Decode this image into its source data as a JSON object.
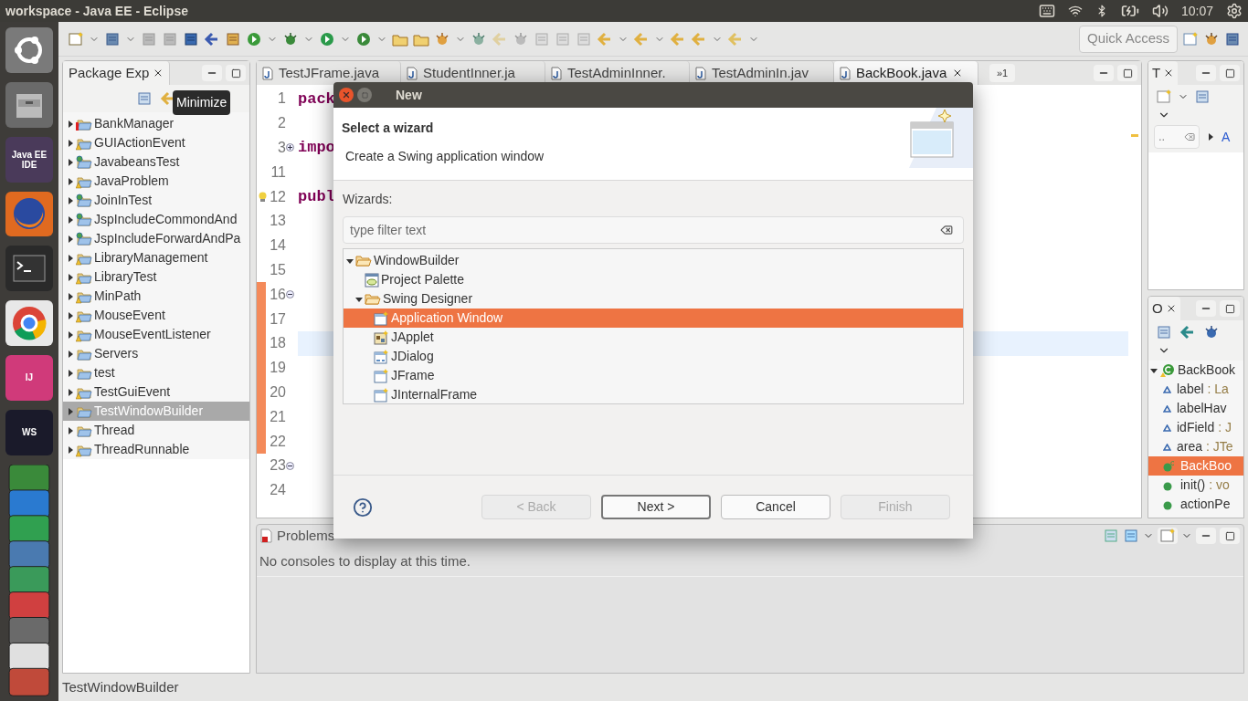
{
  "top_bar": {
    "title": "workspace - Java EE - Eclipse",
    "time": "10:07"
  },
  "launcher": [
    {
      "kind": "ubuntu"
    },
    {
      "kind": "files"
    },
    {
      "kind": "eclipse",
      "label": "Java EE IDE"
    },
    {
      "kind": "firefox"
    },
    {
      "kind": "terminal"
    },
    {
      "kind": "chrome"
    },
    {
      "kind": "intellij",
      "label": "IJ"
    },
    {
      "kind": "webstorm",
      "label": "WS"
    },
    {
      "kind": "stack"
    }
  ],
  "toolbar": {
    "quick_access": "Quick Access"
  },
  "package_explorer": {
    "tab": "Package Exp",
    "tooltip": "Minimize",
    "projects": [
      {
        "name": "BankManager",
        "kind": "error",
        "selected": false
      },
      {
        "name": "GUIActionEvent",
        "kind": "warning",
        "selected": false
      },
      {
        "name": "JavabeansTest",
        "kind": "web",
        "selected": false
      },
      {
        "name": "JavaProblem",
        "kind": "warning",
        "selected": false
      },
      {
        "name": "JoinInTest",
        "kind": "web",
        "selected": false
      },
      {
        "name": "JspIncludeCommondAnd",
        "kind": "web",
        "selected": false
      },
      {
        "name": "JspIncludeForwardAndPa",
        "kind": "web",
        "selected": false
      },
      {
        "name": "LibraryManagement",
        "kind": "warning",
        "selected": false
      },
      {
        "name": "LibraryTest",
        "kind": "warning",
        "selected": false
      },
      {
        "name": "MinPath",
        "kind": "warning",
        "selected": false
      },
      {
        "name": "MouseEvent",
        "kind": "warning",
        "selected": false
      },
      {
        "name": "MouseEventListener",
        "kind": "warning",
        "selected": false
      },
      {
        "name": "Servers",
        "kind": "plain",
        "selected": false
      },
      {
        "name": "test",
        "kind": "plain",
        "selected": false
      },
      {
        "name": "TestGuiEvent",
        "kind": "warning",
        "selected": false
      },
      {
        "name": "TestWindowBuilder",
        "kind": "plain",
        "selected": true
      },
      {
        "name": "Thread",
        "kind": "plain",
        "selected": false
      },
      {
        "name": "ThreadRunnable",
        "kind": "warning",
        "selected": false
      }
    ]
  },
  "editor": {
    "tabs": [
      {
        "label": "TestJFrame.java",
        "selected": false
      },
      {
        "label": "StudentInner.ja",
        "selected": false
      },
      {
        "label": "TestAdminInner.",
        "selected": false
      },
      {
        "label": "TestAdminIn.jav",
        "selected": false
      },
      {
        "label": "BackBook.java",
        "selected": true
      }
    ],
    "overflow": "»1",
    "lines": [
      {
        "number": "1",
        "code": "pack",
        "kind": "plain",
        "changed": false,
        "current": false
      },
      {
        "number": "2",
        "kind": "plain",
        "changed": false,
        "current": false
      },
      {
        "number": "3",
        "code": "impo",
        "kind": "folded",
        "changed": false,
        "current": false
      },
      {
        "number": "11",
        "kind": "plain",
        "changed": false,
        "current": false
      },
      {
        "number": "12",
        "code": "publ",
        "kind": "warning",
        "changed": false,
        "current": false
      },
      {
        "number": "13",
        "kind": "plain",
        "changed": false,
        "current": false
      },
      {
        "number": "14",
        "kind": "plain",
        "changed": false,
        "current": false
      },
      {
        "number": "15",
        "kind": "plain",
        "changed": false,
        "current": false
      },
      {
        "number": "16",
        "kind": "foldable",
        "changed": true,
        "current": false
      },
      {
        "number": "17",
        "kind": "plain",
        "changed": true,
        "current": false
      },
      {
        "number": "18",
        "kind": "plain",
        "changed": true,
        "current": true
      },
      {
        "number": "19",
        "kind": "plain",
        "changed": true,
        "current": false
      },
      {
        "number": "20",
        "kind": "plain",
        "changed": true,
        "current": false
      },
      {
        "number": "21",
        "kind": "plain",
        "changed": true,
        "current": false
      },
      {
        "number": "22",
        "kind": "plain",
        "changed": true,
        "current": false
      },
      {
        "number": "23",
        "kind": "foldable",
        "changed": false,
        "current": false
      },
      {
        "number": "24",
        "kind": "plain",
        "changed": false,
        "current": false
      }
    ]
  },
  "type_hierarchy": {
    "tab": "T",
    "filter": "..",
    "link": "A"
  },
  "outline": {
    "tab": "O",
    "root": "BackBook",
    "members": [
      {
        "name": "label",
        "detail": ": La",
        "kind": "field",
        "selected": false
      },
      {
        "name": "labelHav",
        "kind": "field",
        "selected": false
      },
      {
        "name": "idField",
        "detail": ": J",
        "kind": "field",
        "selected": false
      },
      {
        "name": "area",
        "detail": ": JTe",
        "kind": "field",
        "selected": false
      },
      {
        "name": "BackBoo",
        "kind": "constructor",
        "selected": true
      },
      {
        "name": "init()",
        "detail": ": vo",
        "kind": "method",
        "selected": false
      },
      {
        "name": "actionPe",
        "kind": "method",
        "selected": false
      }
    ]
  },
  "console": {
    "tab": "Problems",
    "message": "No consoles to display at this time."
  },
  "status_bar": {
    "text": "TestWindowBuilder"
  },
  "dialog": {
    "title": "New",
    "heading": "Select a wizard",
    "description": "Create a Swing application window",
    "list_label": "Wizards:",
    "filter_placeholder": "type filter text",
    "tree": [
      {
        "label": "WindowBuilder",
        "kind": "folder",
        "expanded": true,
        "selected": false,
        "children": [
          {
            "label": "Project Palette",
            "kind": "palette",
            "selected": false
          },
          {
            "label": "Swing Designer",
            "kind": "folder",
            "expanded": true,
            "selected": false,
            "children": [
              {
                "label": "Application Window",
                "kind": "window",
                "selected": true
              },
              {
                "label": "JApplet",
                "kind": "applet",
                "selected": false
              },
              {
                "label": "JDialog",
                "kind": "dialog",
                "selected": false
              },
              {
                "label": "JFrame",
                "kind": "window",
                "selected": false
              },
              {
                "label": "JInternalFrame",
                "kind": "window",
                "selected": false
              }
            ]
          }
        ]
      }
    ],
    "buttons": [
      {
        "label": "< Back",
        "disabled": true,
        "default": false
      },
      {
        "label": "Next >",
        "disabled": false,
        "default": true
      },
      {
        "label": "Cancel",
        "disabled": false,
        "default": false
      },
      {
        "label": "Finish",
        "disabled": true,
        "default": false
      }
    ]
  }
}
